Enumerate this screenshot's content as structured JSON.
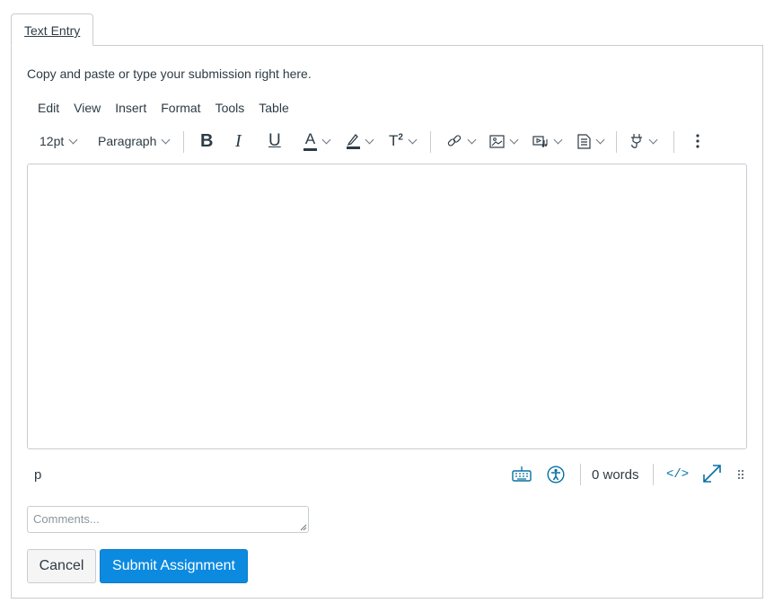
{
  "tabs": [
    {
      "label": "Text Entry",
      "active": true
    }
  ],
  "intro_text": "Copy and paste or type your submission right here.",
  "menubar": [
    "Edit",
    "View",
    "Insert",
    "Format",
    "Tools",
    "Table"
  ],
  "toolbar": {
    "font_size": "12pt",
    "block_format": "Paragraph",
    "buttons": [
      {
        "name": "bold-icon"
      },
      {
        "name": "italic-icon"
      },
      {
        "name": "underline-icon"
      },
      {
        "name": "text-color-icon"
      },
      {
        "name": "highlight-color-icon"
      },
      {
        "name": "superscript-icon"
      },
      {
        "name": "link-icon"
      },
      {
        "name": "image-icon"
      },
      {
        "name": "media-icon"
      },
      {
        "name": "document-icon"
      },
      {
        "name": "apps-plug-icon"
      },
      {
        "name": "more-icon"
      }
    ],
    "superscript_glyph": "T",
    "superscript_sup": "2",
    "bold_glyph": "B",
    "italic_glyph": "I",
    "underline_glyph": "U",
    "textcolor_glyph": "A"
  },
  "editor": {
    "content": ""
  },
  "statusbar": {
    "element_path": "p",
    "word_count": "0 words",
    "html_toggle": "</>"
  },
  "comments": {
    "placeholder": "Comments...",
    "value": ""
  },
  "actions": {
    "cancel": "Cancel",
    "submit": "Submit Assignment"
  },
  "colors": {
    "accent": "#0b8ae0",
    "icon_blue": "#0770a3",
    "text": "#2d3b45",
    "border": "#c7cdd1"
  }
}
